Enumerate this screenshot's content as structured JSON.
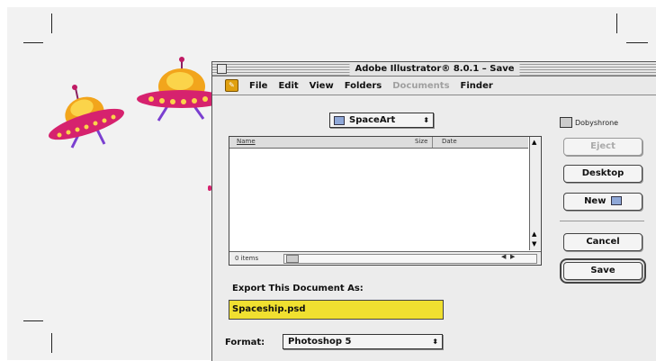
{
  "window": {
    "title": "Adobe Illustrator® 8.0.1 – Save"
  },
  "menubar": {
    "app_icon": "illustrator-app-icon",
    "items": [
      {
        "label": "File",
        "enabled": true
      },
      {
        "label": "Edit",
        "enabled": true
      },
      {
        "label": "View",
        "enabled": true
      },
      {
        "label": "Folders",
        "enabled": true
      },
      {
        "label": "Documents",
        "enabled": false
      },
      {
        "label": "Finder",
        "enabled": true
      }
    ]
  },
  "folder_popup": {
    "label": "SpaceArt",
    "icon": "folder-icon"
  },
  "volume": {
    "label": "Dobyshrone",
    "icon": "disk-icon"
  },
  "file_list": {
    "columns": [
      "Name",
      "Size",
      "Date"
    ],
    "rows": [],
    "footer": "0 items"
  },
  "buttons": {
    "eject": "Eject",
    "desktop": "Desktop",
    "new": "New",
    "cancel": "Cancel",
    "save": "Save"
  },
  "export": {
    "label": "Export This Document As:",
    "filename": "Spaceship.psd"
  },
  "format": {
    "label": "Format:",
    "value": "Photoshop 5"
  },
  "colors": {
    "filename_highlight": "#f0e030",
    "ufo_saucer": "#d6226e",
    "ufo_dome": "#f4b81a"
  }
}
